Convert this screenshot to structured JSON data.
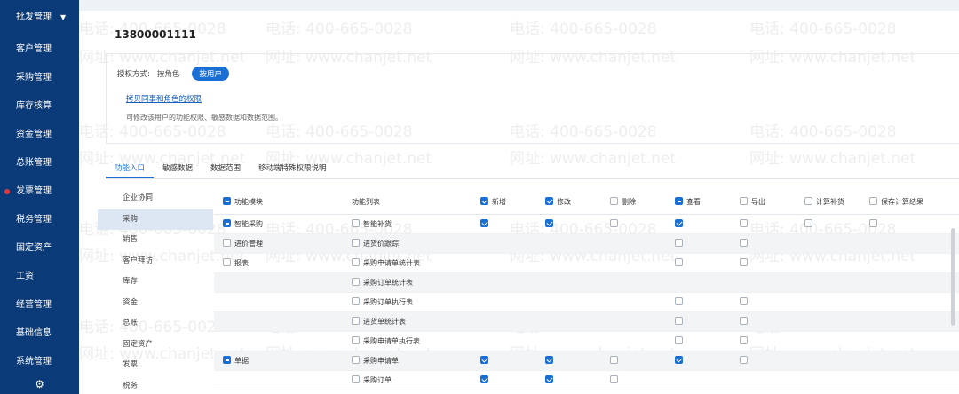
{
  "sidebar": {
    "items": [
      "批发管理",
      "客户管理",
      "采购管理",
      "库存核算",
      "资金管理",
      "总账管理",
      "发票管理",
      "税务管理",
      "固定资产",
      "工资",
      "经营管理",
      "基础信息",
      "系统管理"
    ],
    "caret": "▼",
    "settings_icon": "gear-icon"
  },
  "header": {
    "user_title": "13800001111"
  },
  "auth": {
    "label": "授权方式:",
    "by_role": "按角色",
    "by_user": "按用户",
    "copy_link": "拷贝同事和角色的权限",
    "hint": "可修改该用户的功能权限、敏感数据和数据范围。"
  },
  "tabs": [
    "功能入口",
    "敏感数据",
    "数据范围",
    "移动端特殊权限说明"
  ],
  "modules": [
    "企业协同",
    "采购",
    "销售",
    "客户拜访",
    "库存",
    "资金",
    "总账",
    "固定资产",
    "发票",
    "税务"
  ],
  "table": {
    "headers": [
      "功能模块",
      "功能列表",
      "新增",
      "修改",
      "删除",
      "查看",
      "导出",
      "计算补货",
      "保存计算结果"
    ],
    "rows": [
      {
        "module": "智能采购",
        "func": "智能补货",
        "c": [
          1,
          1,
          0,
          1,
          0,
          0,
          0
        ]
      },
      {
        "module": "进价管理",
        "func": "进货价跟踪",
        "c": [
          -1,
          -1,
          -1,
          0,
          0,
          -1,
          -1
        ]
      },
      {
        "module": "报表",
        "func": "采购申请单统计表",
        "c": [
          -1,
          -1,
          -1,
          0,
          0,
          -1,
          -1
        ]
      },
      {
        "module": "",
        "func": "采购订单统计表",
        "c": [
          -1,
          -1,
          -1,
          -1,
          -1,
          -1,
          -1
        ]
      },
      {
        "module": "",
        "func": "采购订单执行表",
        "c": [
          -1,
          -1,
          -1,
          0,
          0,
          -1,
          -1
        ]
      },
      {
        "module": "",
        "func": "进货单统计表",
        "c": [
          -1,
          -1,
          -1,
          0,
          0,
          -1,
          -1
        ]
      },
      {
        "module": "",
        "func": "采购申请单执行表",
        "c": [
          -1,
          -1,
          -1,
          0,
          0,
          -1,
          -1
        ]
      },
      {
        "module": "单据",
        "func": "采购申请单",
        "c": [
          1,
          1,
          0,
          1,
          0,
          -1,
          -1
        ]
      },
      {
        "module": "",
        "func": "采购订单",
        "c": [
          1,
          1,
          0,
          -1,
          -1,
          -1,
          -1
        ]
      }
    ],
    "header_checks": [
      1,
      1,
      0,
      2,
      0,
      0,
      0
    ],
    "module_checks": [
      2,
      0,
      0,
      -1,
      -1,
      -1,
      -1,
      2,
      -1
    ]
  },
  "watermark": {
    "phone": "电话: 400-665-0028",
    "site": "网址: www.chanjet.net"
  }
}
